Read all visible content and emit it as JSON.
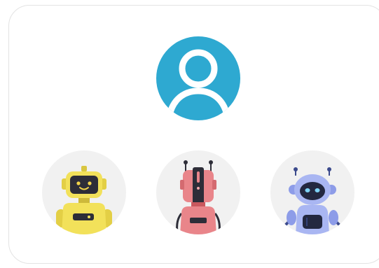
{
  "selected_avatar": {
    "icon": "user-silhouette-icon",
    "background_color": "#2ea9d1"
  },
  "avatar_options": [
    {
      "id": "robot-yellow",
      "icon": "yellow-robot-icon",
      "color": "#f2e15a"
    },
    {
      "id": "robot-red",
      "icon": "red-robot-icon",
      "color": "#e9858a"
    },
    {
      "id": "robot-blue",
      "icon": "blue-robot-icon",
      "color": "#a9b6f2"
    }
  ]
}
